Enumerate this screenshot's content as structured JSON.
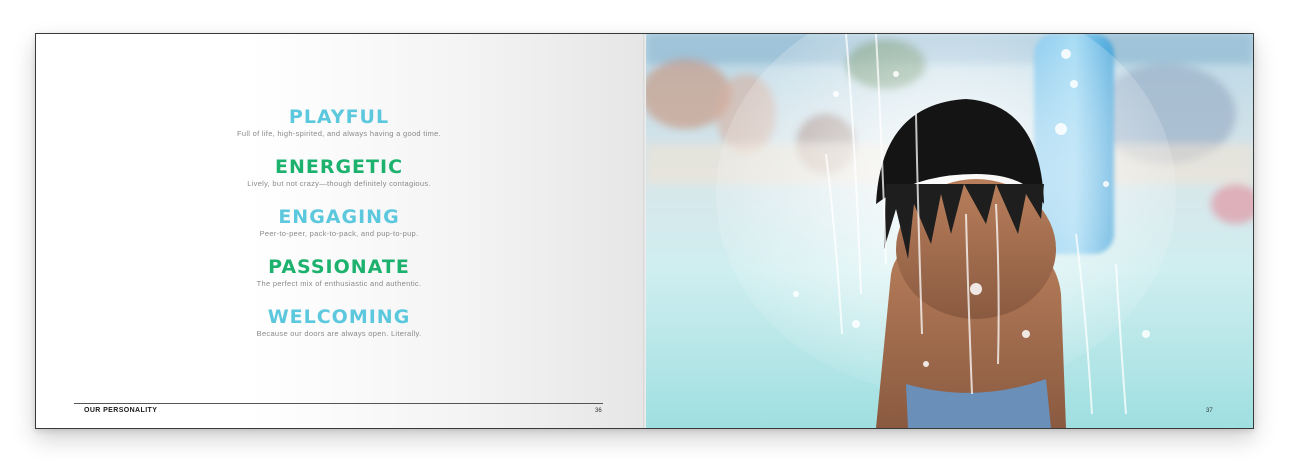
{
  "left_page": {
    "traits": [
      {
        "title": "PLAYFUL",
        "description": "Full of life, high-spirited, and always having a good time.",
        "color": "#5cc8dd"
      },
      {
        "title": "ENERGETIC",
        "description": "Lively, but not crazy—though definitely contagious.",
        "color": "#1cb26e"
      },
      {
        "title": "ENGAGING",
        "description": "Peer-to-peer, pack-to-pack, and pup-to-pup.",
        "color": "#5cc8dd"
      },
      {
        "title": "PASSIONATE",
        "description": "The perfect mix of enthusiastic and authentic.",
        "color": "#1cb26e"
      },
      {
        "title": "WELCOMING",
        "description": "Because our doors are always open. Literally.",
        "color": "#5cc8dd"
      }
    ],
    "footer_title": "OUR PERSONALITY",
    "page_number": "36"
  },
  "right_page": {
    "photo": "child-under-water-fountain-photo",
    "page_number": "37"
  }
}
